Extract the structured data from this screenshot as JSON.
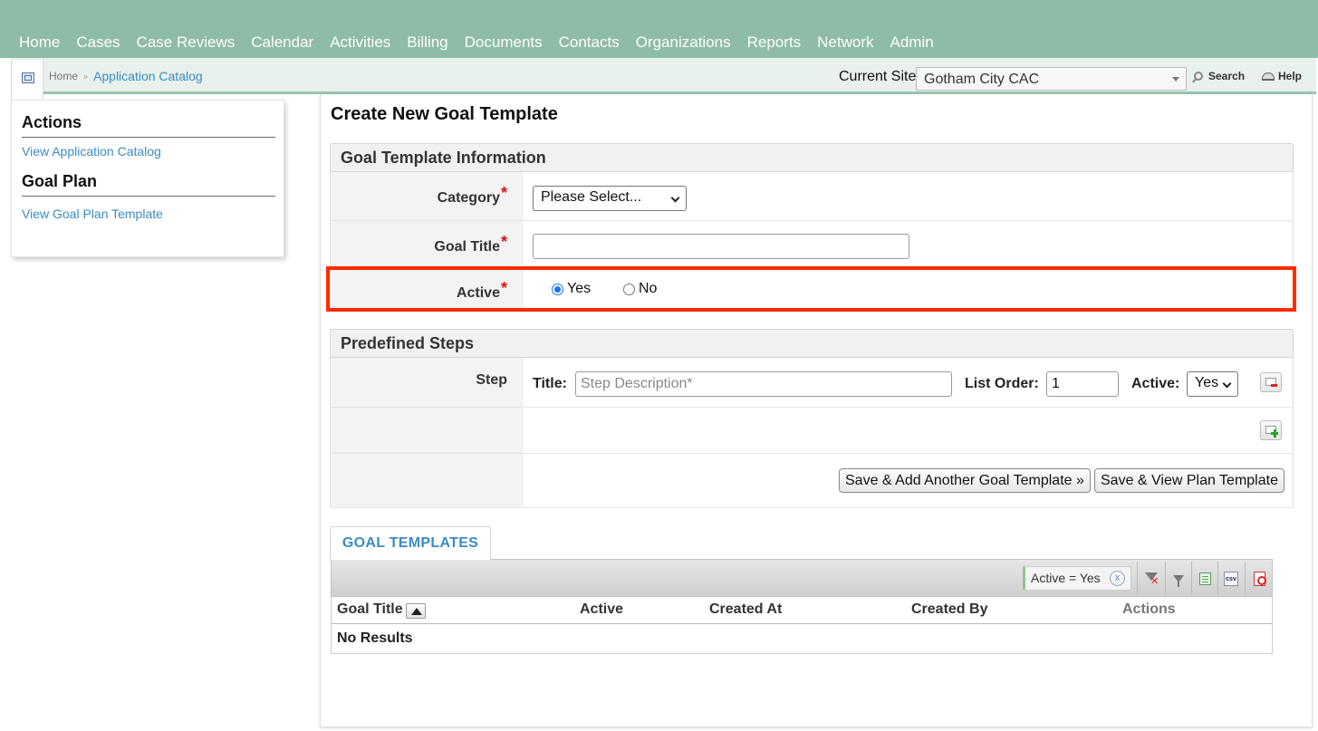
{
  "nav": {
    "items": [
      "Home",
      "Cases",
      "Case Reviews",
      "Calendar",
      "Activities",
      "Billing",
      "Documents",
      "Contacts",
      "Organizations",
      "Reports",
      "Network",
      "Admin"
    ]
  },
  "breadcrumb": {
    "home": "Home",
    "separator": "»",
    "current": "Application Catalog"
  },
  "site": {
    "label": "Current Site",
    "selected": "Gotham City CAC"
  },
  "toolbar": {
    "search_label": "Search",
    "help_label": "Help"
  },
  "sidebar": {
    "actions_heading": "Actions",
    "actions_link": "View Application Catalog",
    "goalplan_heading": "Goal Plan",
    "goalplan_link": "View Goal Plan Template"
  },
  "page": {
    "title": "Create New Goal Template"
  },
  "info_section": {
    "heading": "Goal Template Information",
    "category_label": "Category",
    "category_value": "Please Select...",
    "goal_title_label": "Goal Title",
    "goal_title_value": "",
    "active_label": "Active",
    "active_yes": "Yes",
    "active_no": "No",
    "active_selected": "Yes",
    "required_mark": "*"
  },
  "steps_section": {
    "heading": "Predefined Steps",
    "step_label": "Step",
    "title_label": "Title:",
    "title_placeholder": "Step Description*",
    "list_order_label": "List Order:",
    "list_order_value": "1",
    "active_label": "Active:",
    "active_value": "Yes"
  },
  "buttons": {
    "save_add_another": "Save & Add Another Goal Template »",
    "save_view_plan": "Save & View Plan Template"
  },
  "grid": {
    "tab_label": "GOAL TEMPLATES",
    "filter_chip": "Active = Yes",
    "filter_clear": "x",
    "csv_label": "csv",
    "columns": [
      "Goal Title",
      "Active",
      "Created At",
      "Created By",
      "Actions"
    ],
    "empty_text": "No Results"
  },
  "colors": {
    "nav_bg": "#8fbca6",
    "link": "#3b8cc4",
    "highlight": "#ff2a00",
    "required": "#e01010"
  }
}
